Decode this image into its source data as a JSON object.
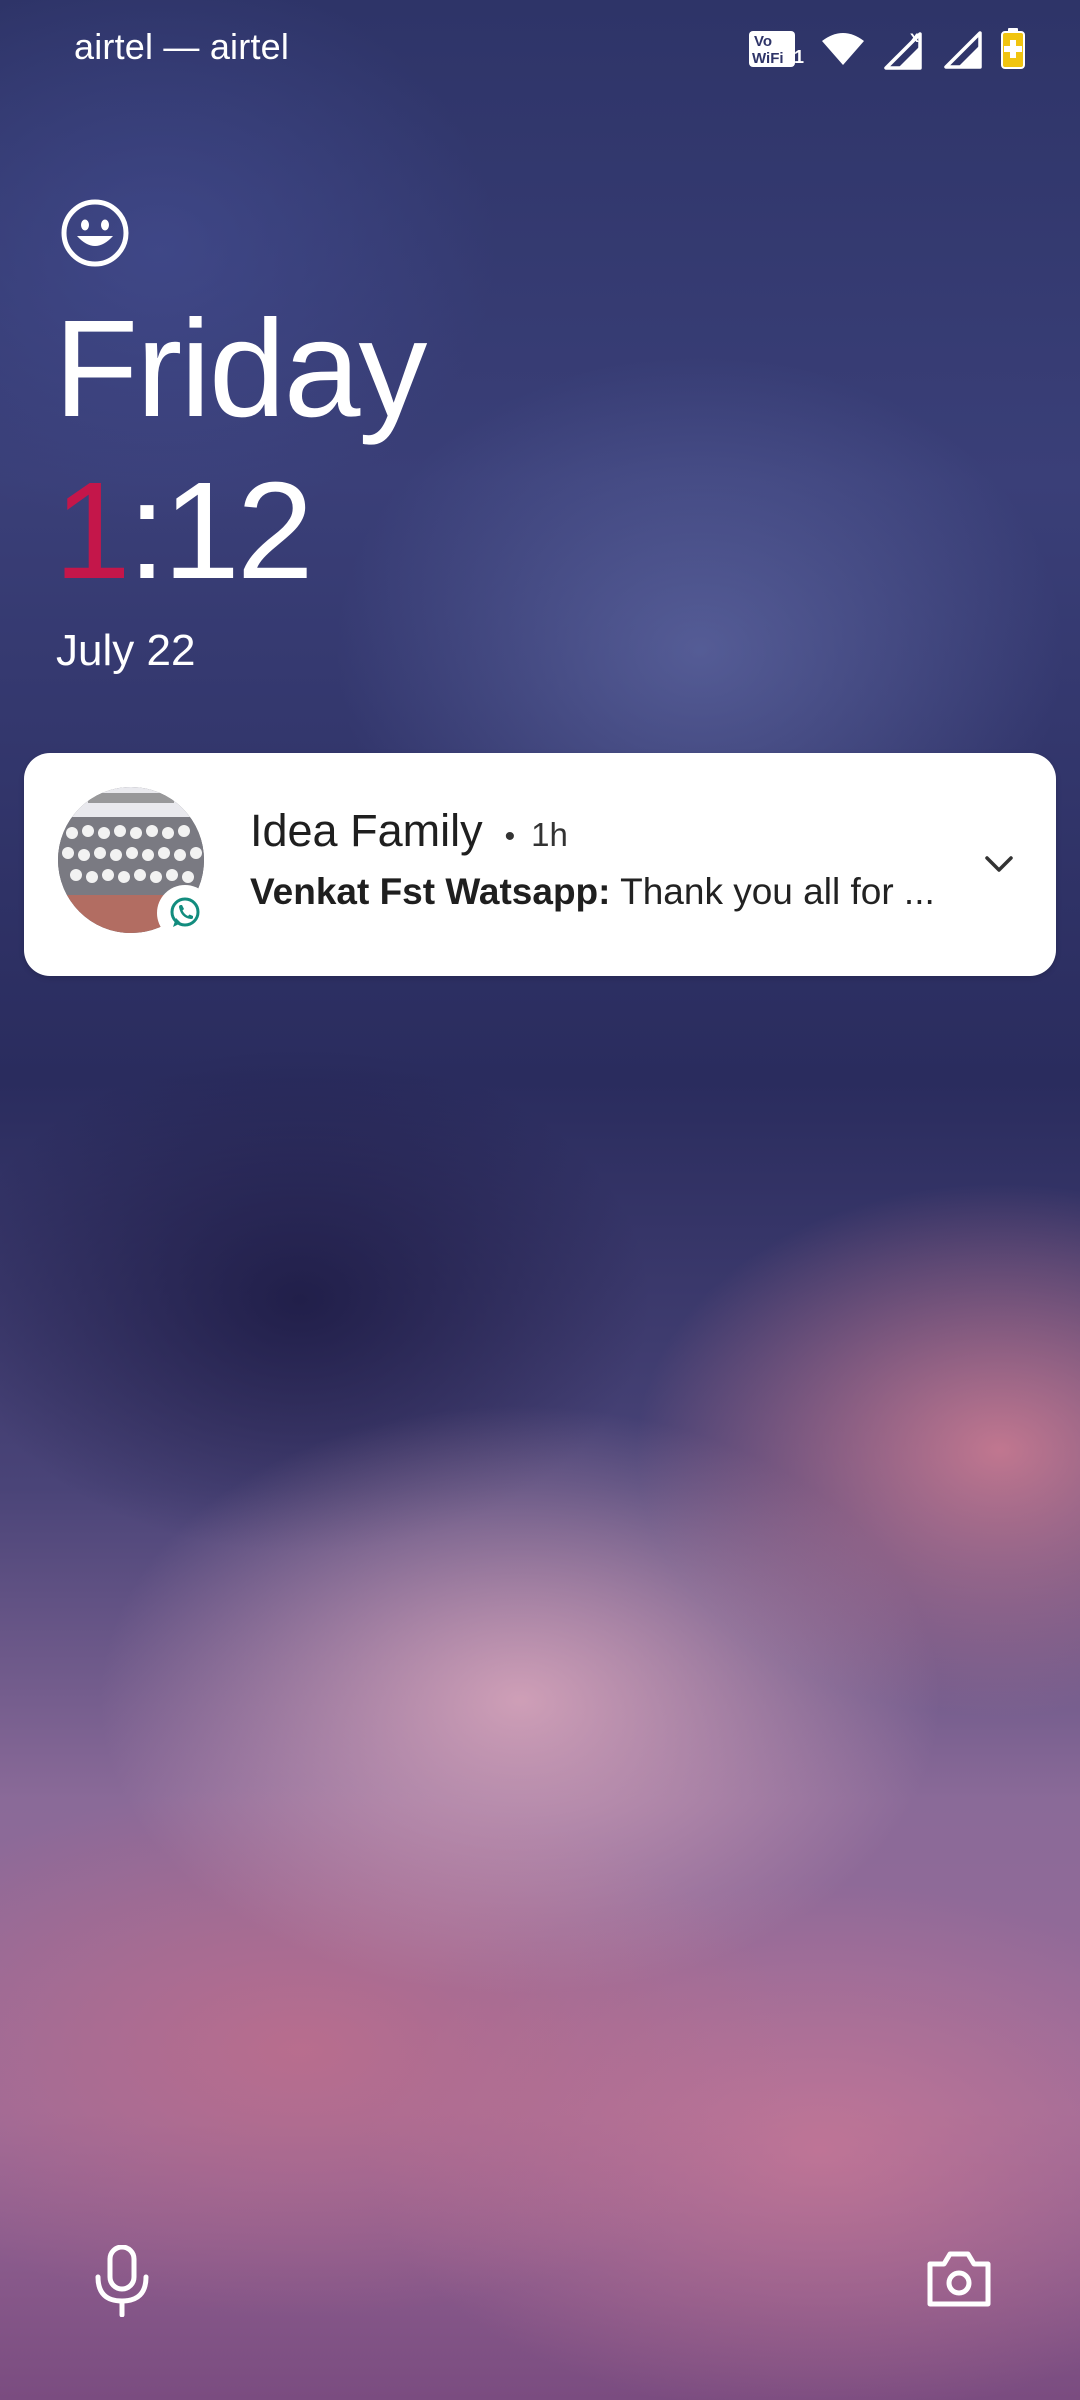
{
  "status_bar": {
    "carrier": "airtel — airtel",
    "icons": [
      "vowifi-icon",
      "wifi-icon",
      "signal-icon-no-data",
      "signal-icon",
      "battery-charging-icon"
    ],
    "vowifi_label_top": "Vo",
    "vowifi_label_bottom": "WiFi",
    "vowifi_sim": "1",
    "signal_mark": "x"
  },
  "lockscreen": {
    "day": "Friday",
    "time_hour_first_digit": "1",
    "time_rest": ":12",
    "date": "July 22",
    "accent_color": "#c4164a"
  },
  "notification": {
    "title": "Idea Family",
    "separator": "•",
    "time": "1h",
    "sender": "Venkat Fst Watsapp:",
    "message": "Thank you all for ...",
    "app_icon": "whatsapp-icon",
    "app_color": "#128c7e"
  },
  "shortcuts": {
    "left": "mic-icon",
    "right": "camera-icon"
  }
}
